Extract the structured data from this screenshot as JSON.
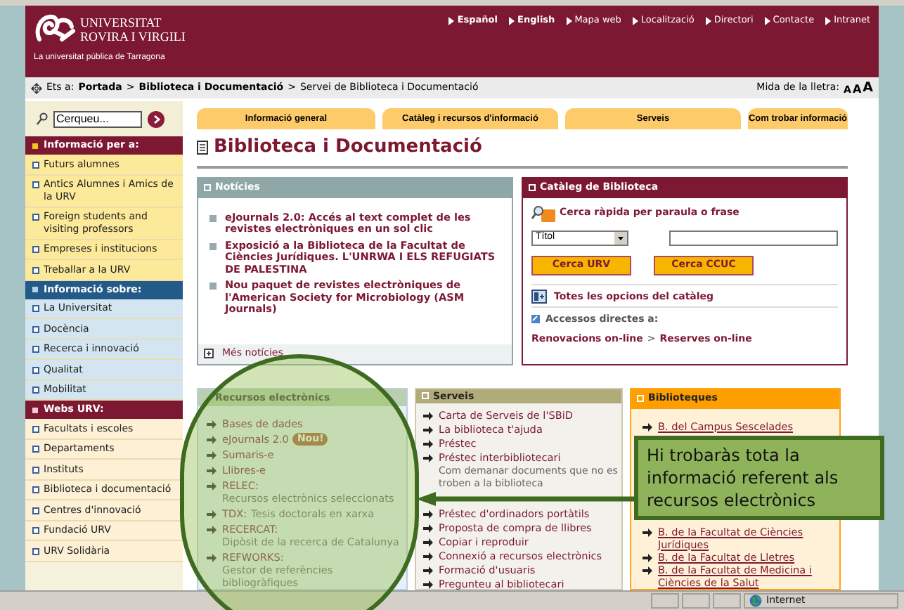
{
  "header": {
    "logo_line1": "UNIVERSITAT",
    "logo_line2": "ROVIRA I VIRGILI",
    "tagline": "La universitat pública de Tarragona",
    "nav": [
      {
        "label": "Español",
        "kind": "language"
      },
      {
        "label": "English",
        "kind": "language"
      },
      {
        "label": "Mapa web",
        "kind": "page"
      },
      {
        "label": "Localització",
        "kind": "page"
      },
      {
        "label": "Directori",
        "kind": "page"
      },
      {
        "label": "Contacte",
        "kind": "page"
      },
      {
        "label": "Intranet",
        "kind": "page"
      }
    ]
  },
  "breadcrumb": {
    "label": "Ets a:",
    "separator": ">",
    "items": [
      {
        "label": "Portada",
        "kind": "link"
      },
      {
        "label": "Biblioteca i Documentació",
        "kind": "link"
      },
      {
        "label": "Servei de Biblioteca i Documentació",
        "kind": "current"
      }
    ]
  },
  "font_size": {
    "label": "Mida de la lletra:",
    "sizes": [
      "A",
      "A",
      "A"
    ]
  },
  "sidebar": {
    "search": {
      "value": "Cerqueu..."
    },
    "sections": [
      {
        "title": "Informació per a:",
        "color": "#7d1832",
        "items": [
          "Futurs alumnes",
          "Antics Alumnes i Amics de la URV",
          "Foreign students and visiting professors",
          "Empreses i institucions",
          "Treballar a la URV"
        ]
      },
      {
        "title": "Informació sobre:",
        "color": "#245a87",
        "items": [
          "La Universitat",
          "Docència",
          "Recerca i innovació",
          "Qualitat",
          "Mobilitat"
        ]
      },
      {
        "title": "Webs URV:",
        "color": "#7d1832",
        "items": [
          "Facultats i escoles",
          "Departaments",
          "Instituts",
          "Biblioteca i documentació",
          "Centres d'innovació",
          "Fundació URV",
          "URV Solidària"
        ]
      }
    ]
  },
  "tabs": [
    "Informació general",
    "Catàleg i recursos d'informació",
    "Serveis",
    "Com trobar informació"
  ],
  "page_title": "Biblioteca i Documentació",
  "news": {
    "title": "Notícies",
    "items": [
      "eJournals 2.0: Accés al text complet de les revistes electròniques en un sol clic",
      "Exposició a la Biblioteca de la Facultat de Ciències Jurídiques. L'UNRWA I ELS REFUGIATS DE PALESTINA",
      "Nou paquet de revistes electròniques de l'American Society for Microbiology (ASM Journals)"
    ],
    "more": "Més notícies"
  },
  "catalog": {
    "title": "Catàleg de Biblioteca",
    "quick_search": "Cerca ràpida per paraula o frase",
    "field_select": "Títol",
    "buttons": [
      "Cerca URV",
      "Cerca CCUC"
    ],
    "all_options": "Totes les opcions del catàleg",
    "direct_label": "Accessos directes a:",
    "separator": ">",
    "direct_links": [
      "Renovacions on-line",
      "Reserves on-line"
    ]
  },
  "resources": {
    "title": "Recursos electrònics",
    "items": [
      {
        "label": "Bases de dades"
      },
      {
        "label": "eJournals 2.0",
        "badge": "Nou!"
      },
      {
        "label": "Sumaris-e"
      },
      {
        "label": "Llibres-e"
      },
      {
        "label": "RELEC:",
        "description": "Recursos electrònics seleccionats"
      },
      {
        "label": "TDX:",
        "description": "Tesis doctorals en xarxa"
      },
      {
        "label": "RECERCAT:",
        "description": "Dipòsit de la recerca de Catalunya"
      },
      {
        "label": "REFWORKS:",
        "description": "Gestor de referències bibliogràfiques"
      }
    ]
  },
  "services": {
    "title": "Serveis",
    "items": [
      {
        "label": "Carta de Serveis de l'SBiD",
        "kind": "link"
      },
      {
        "label": "La biblioteca t'ajuda",
        "kind": "link"
      },
      {
        "label": "Préstec",
        "kind": "link"
      },
      {
        "label": "Préstec interbibliotecari",
        "kind": "link"
      },
      {
        "label": "Com demanar documents que no es troben a la biblioteca",
        "kind": "note"
      },
      {
        "label": "Préstec d'ordinadors portàtils",
        "kind": "link"
      },
      {
        "label": "Proposta de compra de llibres",
        "kind": "link"
      },
      {
        "label": "Copiar i reproduir",
        "kind": "link"
      },
      {
        "label": "Connexió a recursos electrònics",
        "kind": "link"
      },
      {
        "label": "Formació d'usuaris",
        "kind": "link"
      },
      {
        "label": "Pregunteu al bibliotecari",
        "kind": "link"
      }
    ]
  },
  "libraries": {
    "title": "Biblioteques",
    "items_above": [
      "B. del Campus Sescelades"
    ],
    "items_below": [
      "B. de la Facultat de Ciències Jurídiques",
      "B. de la Facultat de Lletres",
      "B. de la Facultat de Medicina i Ciències de la Salut"
    ]
  },
  "callout": {
    "text": "Hi trobaràs tota la informació referent als recursos electrònics"
  },
  "status_bar": {
    "zone": "Internet"
  }
}
